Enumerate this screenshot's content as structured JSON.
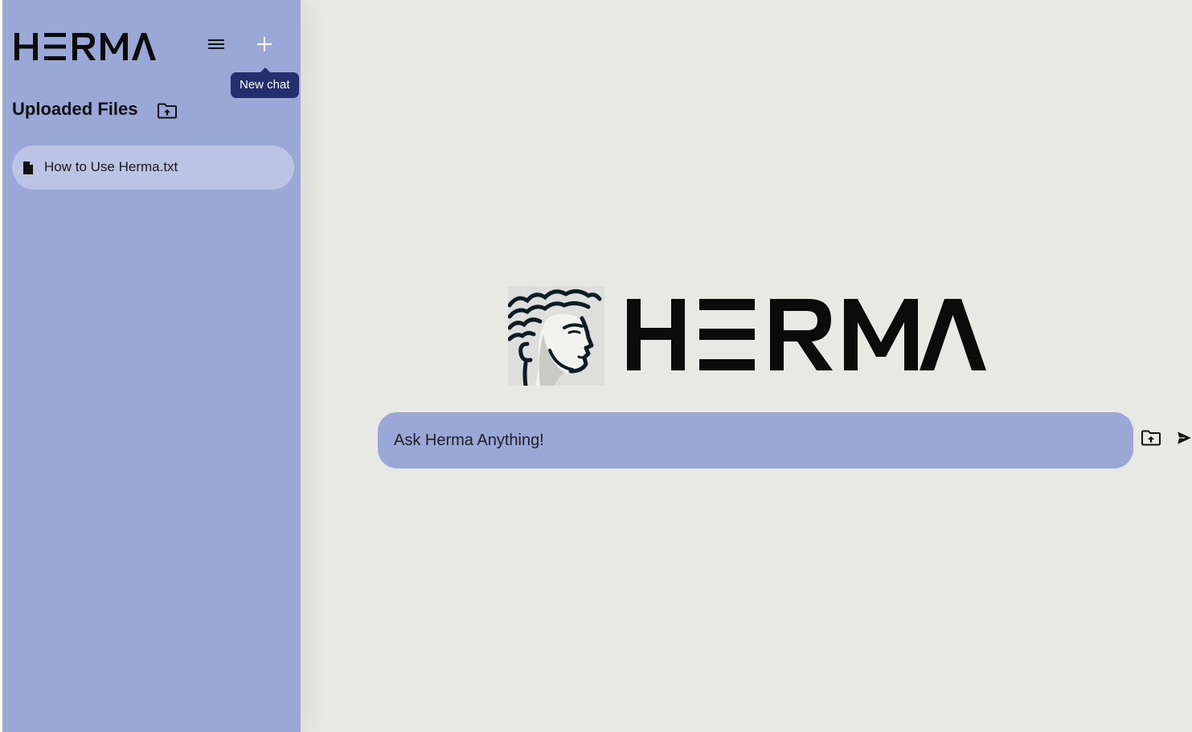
{
  "app": {
    "brand_name": "HERMA"
  },
  "sidebar": {
    "menu_icon": "hamburger-menu-icon",
    "new_chat_icon": "plus-icon",
    "new_chat_tooltip": "New chat",
    "uploaded_files_heading": "Uploaded Files",
    "upload_icon": "folder-upload-icon",
    "files": [
      {
        "name": "How to Use Herma.txt",
        "icon": "file-icon"
      }
    ]
  },
  "main": {
    "hero_wordmark": "HERMA",
    "hero_logo": "greek-head-logo",
    "input_placeholder": "Ask Herma Anything!",
    "attach_icon": "folder-upload-icon",
    "send_icon": "send-icon"
  },
  "colors": {
    "sidebar_bg": "#9aa8d8",
    "file_item_bg": "#bcc4e6",
    "main_bg": "#e8e8e4",
    "tooltip_bg": "#24306e",
    "input_bg": "#9aa8d8"
  }
}
